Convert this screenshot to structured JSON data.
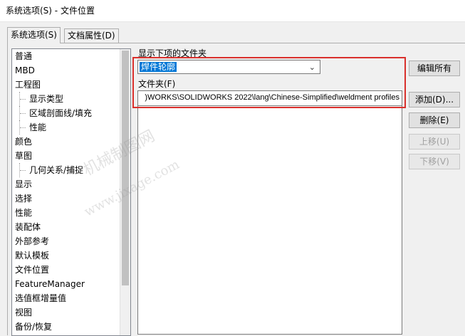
{
  "window": {
    "title": "系统选项(S) - 文件位置"
  },
  "tabs": [
    {
      "label": "系统选项(S)",
      "active": true
    },
    {
      "label": "文档属性(D)",
      "active": false
    }
  ],
  "tree": {
    "items": [
      {
        "label": "普通",
        "level": 0
      },
      {
        "label": "MBD",
        "level": 0
      },
      {
        "label": "工程图",
        "level": 0
      },
      {
        "label": "显示类型",
        "level": 1
      },
      {
        "label": "区域剖面线/填充",
        "level": 1
      },
      {
        "label": "性能",
        "level": 1
      },
      {
        "label": "颜色",
        "level": 0
      },
      {
        "label": "草图",
        "level": 0
      },
      {
        "label": "几何关系/捕捉",
        "level": 1
      },
      {
        "label": "显示",
        "level": 0
      },
      {
        "label": "选择",
        "level": 0
      },
      {
        "label": "性能",
        "level": 0
      },
      {
        "label": "装配体",
        "level": 0
      },
      {
        "label": "外部参考",
        "level": 0
      },
      {
        "label": "默认模板",
        "level": 0
      },
      {
        "label": "文件位置",
        "level": 0
      },
      {
        "label": "FeatureManager",
        "level": 0
      },
      {
        "label": "选值框增量值",
        "level": 0
      },
      {
        "label": "视图",
        "level": 0
      },
      {
        "label": "备份/恢复",
        "level": 0
      }
    ]
  },
  "main": {
    "show_folders_label": "显示下项的文件夹",
    "combo_value": "焊件轮廓",
    "folder_label": "文件夹(F)",
    "folder_path": ")WORKS\\SOLIDWORKS 2022\\lang\\Chinese-Simplified\\weldment profiles"
  },
  "buttons": {
    "edit_all": "编辑所有",
    "add": "添加(D)...",
    "delete": "删除(E)",
    "move_up": "上移(U)",
    "move_down": "下移(V)"
  },
  "watermark": {
    "line1": "机械制图网",
    "line2": "www.jixage.com"
  },
  "colors": {
    "highlight_border": "#d9302c",
    "selection": "#0078d7"
  }
}
